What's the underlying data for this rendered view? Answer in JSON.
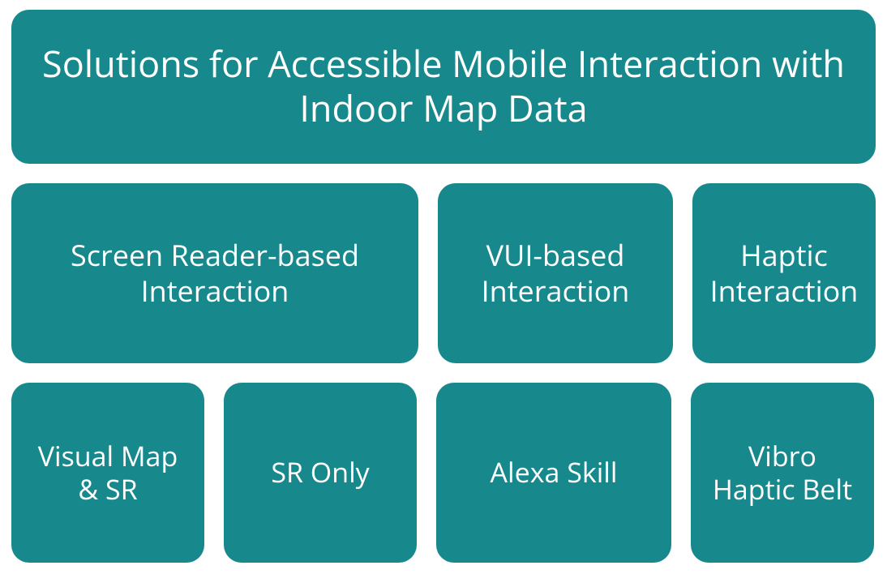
{
  "title": "Solutions for Accessible Mobile Interaction with Indoor Map Data",
  "categories": {
    "screenReader": "Screen Reader-based Interaction",
    "vui": "VUI-based Interaction",
    "haptic": "Haptic Interaction"
  },
  "leaves": {
    "visualMapSr": "Visual Map & SR",
    "srOnly": "SR Only",
    "alexaSkill": "Alexa Skill",
    "vibroHapticBelt": "Vibro Haptic Belt"
  },
  "colors": {
    "box": "#17888c",
    "text": "#ffffff"
  }
}
